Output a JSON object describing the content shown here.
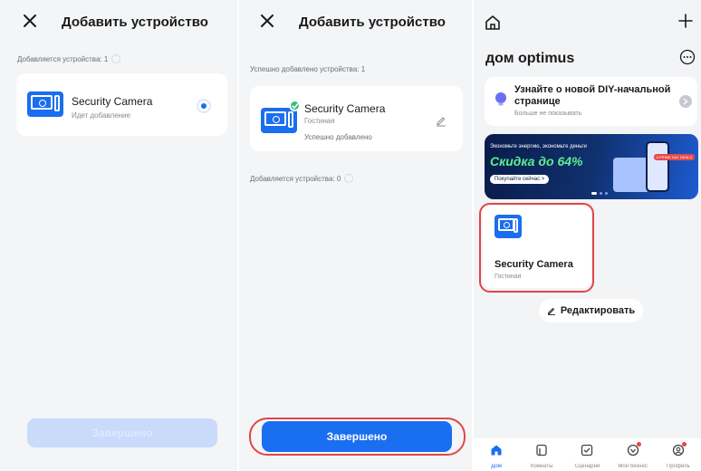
{
  "panel1": {
    "title": "Добавить устройство",
    "status": "Добавляется устройства: 1",
    "device": {
      "name": "Security Camera",
      "status": "Идет добавление"
    },
    "done_button": "Завершено"
  },
  "panel2": {
    "title": "Добавить устройство",
    "added_status": "Успешно добавлено устройства: 1",
    "device": {
      "name": "Security Camera",
      "room": "Гостиная",
      "status": "Успешно добавлено"
    },
    "adding_status": "Добавляется устройства: 0",
    "done_button": "Завершено"
  },
  "panel3": {
    "home_name": "дом optimus",
    "tip": {
      "text": "Узнайте о новой DIY-начальной странице",
      "hide": "Больше не показывать"
    },
    "banner": {
      "line1": "Экономьте энергию, экономьте деньги",
      "line2": "Скидка до 64%",
      "button": "Покупайте сейчас >",
      "tag": "A PRIME DAY DEALS"
    },
    "device": {
      "name": "Security Camera",
      "room": "Гостиная"
    },
    "edit_button": "Редактировать",
    "tabs": [
      {
        "label": "Дом",
        "icon": "home-icon",
        "active": true
      },
      {
        "label": "Комнаты",
        "icon": "rooms-icon",
        "active": false
      },
      {
        "label": "Сценарий",
        "icon": "scene-icon",
        "active": false
      },
      {
        "label": "Мой бизнес",
        "icon": "shop-icon",
        "active": false
      },
      {
        "label": "Профиль",
        "icon": "profile-icon",
        "active": false
      }
    ]
  },
  "colors": {
    "accent": "#1a6ef0",
    "highlight": "#e04646",
    "success": "#2ec27e"
  }
}
